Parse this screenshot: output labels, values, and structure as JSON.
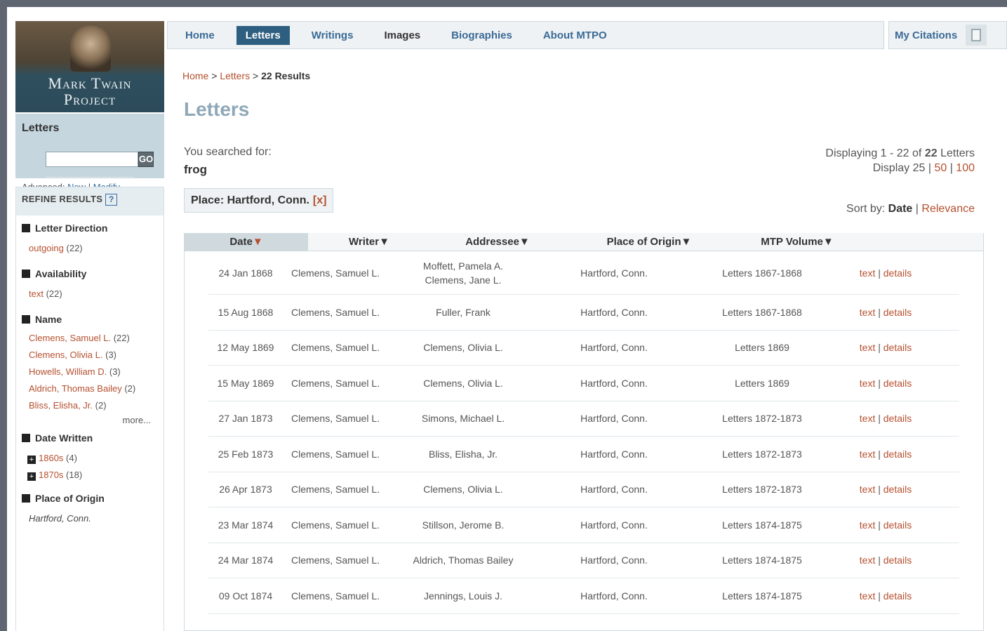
{
  "logo": {
    "line1": "Mark Twain",
    "line2": "Project"
  },
  "search": {
    "label": "Letters",
    "go": "GO",
    "advanced": "Advanced:",
    "new": "New",
    "modify": "Modify",
    "value": ""
  },
  "nav": {
    "items": [
      "Home",
      "Letters",
      "Writings",
      "Images",
      "Biographies",
      "About MTPO"
    ],
    "active": "Letters"
  },
  "citations": {
    "label": "My Citations"
  },
  "breadcrumb": {
    "home": "Home",
    "letters": "Letters",
    "current": "22 Results",
    "sep": ">"
  },
  "page_title": "Letters",
  "searched_for": {
    "label": "You searched for:",
    "term": "frog"
  },
  "filter": {
    "label": "Place: Hartford, Conn.",
    "remove": "[x]"
  },
  "displaying": {
    "prefix": "Displaying 1 - 22 of",
    "count": "22",
    "suffix": "Letters",
    "display_label": "Display",
    "opt_25": "25",
    "opt_50": "50",
    "opt_100": "100"
  },
  "sort": {
    "label": "Sort by:",
    "current": "Date",
    "sep": "|",
    "other": "Relevance"
  },
  "refine": {
    "title": "REFINE RESULTS",
    "help": "?",
    "letter_direction": {
      "title": "Letter Direction",
      "items": [
        {
          "label": "outgoing",
          "count": "(22)"
        }
      ]
    },
    "availability": {
      "title": "Availability",
      "items": [
        {
          "label": "text",
          "count": "(22)"
        }
      ]
    },
    "name": {
      "title": "Name",
      "items": [
        {
          "label": "Clemens, Samuel L.",
          "count": "(22)"
        },
        {
          "label": "Clemens, Olivia L.",
          "count": "(3)"
        },
        {
          "label": "Howells, William D.",
          "count": "(3)"
        },
        {
          "label": "Aldrich, Thomas Bailey",
          "count": "(2)"
        },
        {
          "label": "Bliss, Elisha, Jr.",
          "count": "(2)"
        }
      ],
      "more": "more..."
    },
    "date_written": {
      "title": "Date Written",
      "items": [
        {
          "label": "1860s",
          "count": "(4)"
        },
        {
          "label": "1870s",
          "count": "(18)"
        }
      ]
    },
    "place_of_origin": {
      "title": "Place of Origin",
      "items": [
        {
          "label": "Hartford, Conn."
        }
      ]
    }
  },
  "table": {
    "headers": {
      "date": "Date",
      "writer": "Writer",
      "addressee": "Addressee",
      "place": "Place of Origin",
      "volume": "MTP Volume"
    },
    "link_text": "text",
    "link_details": "details",
    "rows": [
      {
        "date": "24 Jan 1868",
        "writer": "Clemens, Samuel L.",
        "addressee": "Moffett, Pamela A.",
        "addressee2": "Clemens, Jane L.",
        "place": "Hartford, Conn.",
        "volume": "Letters 1867-1868"
      },
      {
        "date": "15 Aug 1868",
        "writer": "Clemens, Samuel L.",
        "addressee": "Fuller, Frank",
        "place": "Hartford, Conn.",
        "volume": "Letters 1867-1868"
      },
      {
        "date": "12 May 1869",
        "writer": "Clemens, Samuel L.",
        "addressee": "Clemens, Olivia L.",
        "place": "Hartford, Conn.",
        "volume": "Letters 1869"
      },
      {
        "date": "15 May 1869",
        "writer": "Clemens, Samuel L.",
        "addressee": "Clemens, Olivia L.",
        "place": "Hartford, Conn.",
        "volume": "Letters 1869"
      },
      {
        "date": "27 Jan 1873",
        "writer": "Clemens, Samuel L.",
        "addressee": "Simons, Michael L.",
        "place": "Hartford, Conn.",
        "volume": "Letters 1872-1873"
      },
      {
        "date": "25 Feb 1873",
        "writer": "Clemens, Samuel L.",
        "addressee": "Bliss, Elisha, Jr.",
        "place": "Hartford, Conn.",
        "volume": "Letters 1872-1873"
      },
      {
        "date": "26 Apr 1873",
        "writer": "Clemens, Samuel L.",
        "addressee": "Clemens, Olivia L.",
        "place": "Hartford, Conn.",
        "volume": "Letters 1872-1873"
      },
      {
        "date": "23 Mar 1874",
        "writer": "Clemens, Samuel L.",
        "addressee": "Stillson, Jerome B.",
        "place": "Hartford, Conn.",
        "volume": "Letters 1874-1875"
      },
      {
        "date": "24 Mar 1874",
        "writer": "Clemens, Samuel L.",
        "addressee": "Aldrich, Thomas Bailey",
        "place": "Hartford, Conn.",
        "volume": "Letters 1874-1875"
      },
      {
        "date": "09 Oct 1874",
        "writer": "Clemens, Samuel L.",
        "addressee": "Jennings, Louis J.",
        "place": "Hartford, Conn.",
        "volume": "Letters 1874-1875"
      }
    ]
  }
}
